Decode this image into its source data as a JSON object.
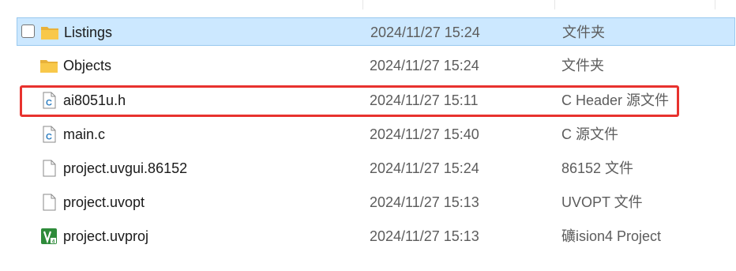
{
  "colors": {
    "selection_bg": "#cce8ff",
    "selection_border": "#99c9ef",
    "highlight_annotation": "#e8322e",
    "folder_yellow": "#f8c84a",
    "header_file_blue": "#2f7fc1",
    "keil_green": "#2e8b3a"
  },
  "files": [
    {
      "name": "Listings",
      "date": "2024/11/27 15:24",
      "type": "文件夹",
      "icon": "folder-icon",
      "selected": true
    },
    {
      "name": "Objects",
      "date": "2024/11/27 15:24",
      "type": "文件夹",
      "icon": "folder-icon"
    },
    {
      "name": "ai8051u.h",
      "date": "2024/11/27 15:11",
      "type": "C Header 源文件",
      "icon": "c-header-file-icon",
      "highlighted": true
    },
    {
      "name": "main.c",
      "date": "2024/11/27 15:40",
      "type": "C 源文件",
      "icon": "c-source-file-icon"
    },
    {
      "name": "project.uvgui.86152",
      "date": "2024/11/27 15:24",
      "type": "86152 文件",
      "icon": "generic-file-icon"
    },
    {
      "name": "project.uvopt",
      "date": "2024/11/27 15:13",
      "type": "UVOPT 文件",
      "icon": "generic-file-icon"
    },
    {
      "name": "project.uvproj",
      "date": "2024/11/27 15:13",
      "type": "礦ision4 Project",
      "icon": "keil-uvision-file-icon"
    }
  ]
}
